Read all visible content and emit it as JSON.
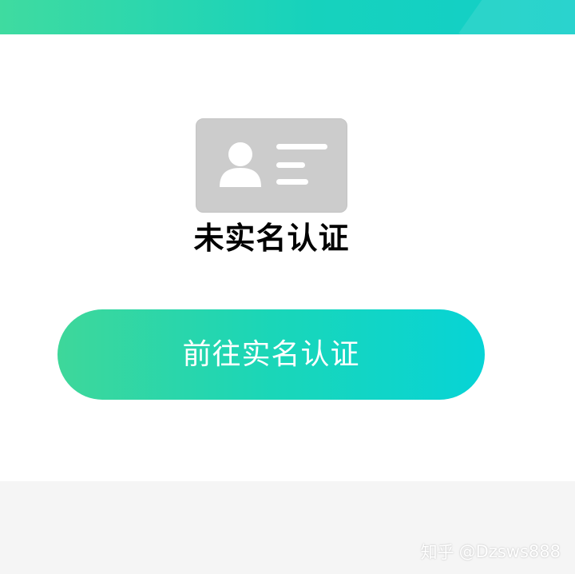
{
  "header": {
    "accent_color": "#16d2bd"
  },
  "verification": {
    "icon": "id-card-icon",
    "status_title": "未实名认证",
    "button_label": "前往实名认证",
    "button_gradient": [
      "#3ed79a",
      "#07d4d6"
    ]
  },
  "watermark": {
    "platform": "知乎",
    "handle": "@Dzsws888"
  }
}
